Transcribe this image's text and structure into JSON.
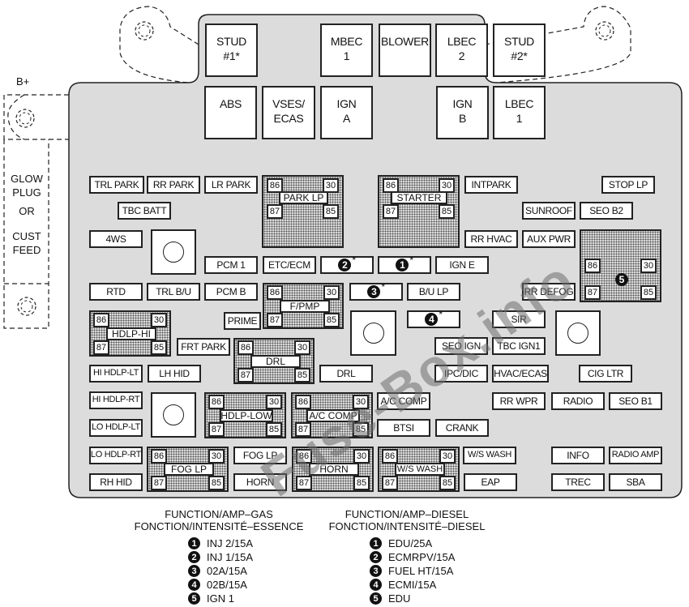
{
  "title": "Underhood Fuse Block",
  "side": {
    "bplus_label": "B+",
    "glow_label_lines": [
      "GLOW",
      "PLUG",
      "OR",
      "CUST",
      "FEED"
    ]
  },
  "top_row": [
    {
      "id": "stud1",
      "lines": [
        "STUD",
        "#1*"
      ]
    },
    {
      "id": "mbec1",
      "lines": [
        "MBEC",
        "1"
      ]
    },
    {
      "id": "blower",
      "lines": [
        "BLOWER"
      ]
    },
    {
      "id": "lbec2",
      "lines": [
        "LBEC",
        "2"
      ]
    },
    {
      "id": "stud2",
      "lines": [
        "STUD",
        "#2*"
      ]
    }
  ],
  "second_row": [
    {
      "id": "abs",
      "lines": [
        "ABS"
      ]
    },
    {
      "id": "vses",
      "lines": [
        "VSES/",
        "ECAS"
      ]
    },
    {
      "id": "igna",
      "lines": [
        "IGN",
        "A"
      ]
    },
    {
      "id": "ignb",
      "lines": [
        "IGN",
        "B"
      ]
    },
    {
      "id": "lbec1",
      "lines": [
        "LBEC",
        "1"
      ]
    }
  ],
  "fuses": [
    {
      "id": "trl_park",
      "label": "TRL PARK"
    },
    {
      "id": "rr_park",
      "label": "RR PARK"
    },
    {
      "id": "lr_park",
      "label": "LR PARK"
    },
    {
      "id": "intpark",
      "label": "INTPARK"
    },
    {
      "id": "stop_lp",
      "label": "STOP LP"
    },
    {
      "id": "tbc_batt",
      "label": "TBC BATT"
    },
    {
      "id": "sunroof",
      "label": "SUNROOF"
    },
    {
      "id": "seo_b2",
      "label": "SEO B2"
    },
    {
      "id": "4ws",
      "label": "4WS"
    },
    {
      "id": "rr_hvac",
      "label": "RR HVAC"
    },
    {
      "id": "aux_pwr",
      "label": "AUX PWR"
    },
    {
      "id": "pcm1",
      "label": "PCM 1"
    },
    {
      "id": "etc_ecm",
      "label": "ETC/ECM"
    },
    {
      "id": "ign_e",
      "label": "IGN E"
    },
    {
      "id": "rtd",
      "label": "RTD"
    },
    {
      "id": "trl_bu",
      "label": "TRL B/U"
    },
    {
      "id": "pcm_b",
      "label": "PCM B"
    },
    {
      "id": "bu_lp",
      "label": "B/U LP"
    },
    {
      "id": "rr_defog",
      "label": "RR DEFOG"
    },
    {
      "id": "prime",
      "label": "PRIME"
    },
    {
      "id": "sir",
      "label": "SIR"
    },
    {
      "id": "frt_park",
      "label": "FRT PARK"
    },
    {
      "id": "seo_ign",
      "label": "SEO IGN"
    },
    {
      "id": "tbc_ign1",
      "label": "TBC IGN1"
    },
    {
      "id": "hi_hdlp_lt",
      "label": "HI HDLP-LT"
    },
    {
      "id": "lh_hid",
      "label": "LH HID"
    },
    {
      "id": "drl_fuse",
      "label": "DRL"
    },
    {
      "id": "ipc_dic",
      "label": "IPC/DIC"
    },
    {
      "id": "hvac_ecas",
      "label": "HVAC/ECAS"
    },
    {
      "id": "cig_ltr",
      "label": "CIG LTR"
    },
    {
      "id": "hi_hdlp_rt",
      "label": "HI HDLP-RT"
    },
    {
      "id": "ac_comp_fuse",
      "label": "A/C COMP"
    },
    {
      "id": "rr_wpr",
      "label": "RR WPR"
    },
    {
      "id": "radio",
      "label": "RADIO"
    },
    {
      "id": "seo_b1",
      "label": "SEO B1"
    },
    {
      "id": "lo_hdlp_lt",
      "label": "LO HDLP-LT"
    },
    {
      "id": "btsi",
      "label": "BTSI"
    },
    {
      "id": "crank",
      "label": "CRANK"
    },
    {
      "id": "lo_hdlp_rt",
      "label": "LO HDLP-RT"
    },
    {
      "id": "fog_lp_fuse",
      "label": "FOG LP"
    },
    {
      "id": "ws_wash_fuse",
      "label": "W/S WASH"
    },
    {
      "id": "info",
      "label": "INFO"
    },
    {
      "id": "radio_amp",
      "label": "RADIO AMP"
    },
    {
      "id": "rh_hid",
      "label": "RH HID"
    },
    {
      "id": "horn_fuse",
      "label": "HORN"
    },
    {
      "id": "eap",
      "label": "EAP"
    },
    {
      "id": "trec",
      "label": "TREC"
    },
    {
      "id": "sba",
      "label": "SBA"
    }
  ],
  "numbered_fuses": [
    {
      "id": "n2",
      "num": "2",
      "mark": "*"
    },
    {
      "id": "n1",
      "num": "1",
      "mark": "*"
    },
    {
      "id": "n3",
      "num": "3",
      "mark": "*"
    },
    {
      "id": "n4",
      "num": "4",
      "mark": "*"
    }
  ],
  "relays": [
    {
      "id": "park_lp",
      "label": "PARK LP",
      "pins": [
        "86",
        "30",
        "87",
        "85"
      ]
    },
    {
      "id": "starter",
      "label": "STARTER",
      "pins": [
        "86",
        "30",
        "87",
        "85"
      ]
    },
    {
      "id": "relay5",
      "label": "5",
      "pins": [
        "86",
        "30",
        "87",
        "85"
      ]
    },
    {
      "id": "fpmp",
      "label": "F/PMP",
      "pins": [
        "86",
        "30",
        "87",
        "85"
      ]
    },
    {
      "id": "hdlp_hi",
      "label": "HDLP-HI",
      "pins": [
        "86",
        "30",
        "87",
        "85"
      ]
    },
    {
      "id": "drl",
      "label": "DRL",
      "pins": [
        "86",
        "30",
        "87",
        "85"
      ]
    },
    {
      "id": "hdlp_low",
      "label": "HDLP-LOW",
      "pins": [
        "86",
        "30",
        "87",
        "85"
      ]
    },
    {
      "id": "ac_comp",
      "label": "A/C COMP",
      "pins": [
        "86",
        "30",
        "87",
        "85"
      ]
    },
    {
      "id": "fog_lp",
      "label": "FOG LP",
      "pins": [
        "86",
        "30",
        "87",
        "85"
      ]
    },
    {
      "id": "horn",
      "label": "HORN",
      "pins": [
        "86",
        "30",
        "87",
        "85"
      ]
    },
    {
      "id": "ws_wash",
      "label": "W/S WASH",
      "pins": [
        "86",
        "30",
        "87",
        "85"
      ]
    }
  ],
  "legend": {
    "gas": {
      "title": "FUNCTION/AMP–GAS",
      "title_fr": "FONCTION/INTENSITÉ–ESSENCE",
      "items": [
        {
          "num": "1",
          "text": "INJ 2/15A"
        },
        {
          "num": "2",
          "text": "INJ 1/15A"
        },
        {
          "num": "3",
          "text": "02A/15A"
        },
        {
          "num": "4",
          "text": "02B/15A"
        },
        {
          "num": "5",
          "text": "IGN 1"
        }
      ]
    },
    "diesel": {
      "title": "FUNCTION/AMP–DIESEL",
      "title_fr": "FONCTION/INTENSITÉ–DIESEL",
      "items": [
        {
          "num": "1",
          "text": "EDU/25A"
        },
        {
          "num": "2",
          "text": "ECMRPV/15A"
        },
        {
          "num": "3",
          "text": "FUEL HT/15A"
        },
        {
          "num": "4",
          "text": "ECMI/15A"
        },
        {
          "num": "5",
          "text": "EDU"
        }
      ]
    }
  },
  "watermark": "Fuse-Box.info",
  "colors": {
    "housing": "#dcdcdc",
    "outline": "#222222",
    "relay_fill": "#d8d8d8"
  }
}
